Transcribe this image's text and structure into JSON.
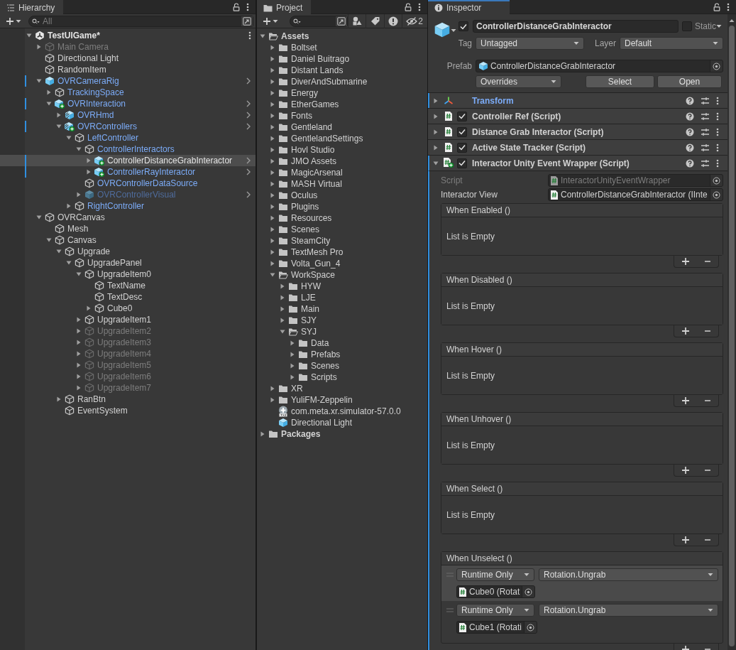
{
  "hierarchy": {
    "tab": "Hierarchy",
    "search": {
      "placeholder": "All"
    },
    "items": [
      {
        "name": "TestUIGame*",
        "kind": "scene",
        "expanded": true,
        "selected": false,
        "children": [
          {
            "name": "Main Camera",
            "kind": "cube",
            "active": false,
            "expanded": false,
            "selected": false
          },
          {
            "name": "Directional Light",
            "kind": "cube",
            "selected": false
          },
          {
            "name": "RandomItem",
            "kind": "cube",
            "selected": false
          },
          {
            "name": "OVRCameraRig",
            "kind": "prefab",
            "prefab": true,
            "modified": true,
            "open_prefab": true,
            "expanded": true,
            "selected": false,
            "children": [
              {
                "name": "TrackingSpace",
                "kind": "cube",
                "prefab": true,
                "expanded": false,
                "selected": false
              },
              {
                "name": "OVRInteraction",
                "kind": "prefab-added",
                "prefab": true,
                "modified": true,
                "open_prefab": true,
                "expanded": true,
                "selected": false,
                "children": [
                  {
                    "name": "OVRHmd",
                    "kind": "variant",
                    "prefab": true,
                    "open_prefab": true,
                    "expanded": false,
                    "selected": false
                  },
                  {
                    "name": "OVRControllers",
                    "kind": "variant-added",
                    "prefab": true,
                    "modified": true,
                    "open_prefab": true,
                    "expanded": true,
                    "selected": false,
                    "children": [
                      {
                        "name": "LeftController",
                        "kind": "cube",
                        "prefab": true,
                        "expanded": true,
                        "selected": false,
                        "children": [
                          {
                            "name": "ControllerInteractors",
                            "kind": "cube",
                            "prefab": true,
                            "expanded": true,
                            "selected": false,
                            "children": [
                              {
                                "name": "ControllerDistanceGrabInteractor",
                                "kind": "prefab-added",
                                "modified": true,
                                "open_prefab": true,
                                "expanded": false,
                                "selected": true
                              },
                              {
                                "name": "ControllerRayInteractor",
                                "kind": "prefab-added",
                                "prefab": true,
                                "modified": true,
                                "open_prefab": true,
                                "expanded": false,
                                "selected": false
                              }
                            ]
                          },
                          {
                            "name": "OVRControllerDataSource",
                            "kind": "cube",
                            "prefab": true,
                            "selected": false
                          },
                          {
                            "name": "OVRControllerVisual",
                            "kind": "prefab",
                            "prefab": true,
                            "active": false,
                            "open_prefab": true,
                            "expanded": false,
                            "selected": false
                          }
                        ]
                      },
                      {
                        "name": "RightController",
                        "kind": "cube",
                        "prefab": true,
                        "expanded": false,
                        "selected": false
                      }
                    ]
                  }
                ]
              }
            ]
          },
          {
            "name": "OVRCanvas",
            "kind": "cube",
            "expanded": true,
            "selected": false,
            "children": [
              {
                "name": "Mesh",
                "kind": "cube",
                "selected": false
              },
              {
                "name": "Canvas",
                "kind": "cube",
                "expanded": true,
                "selected": false,
                "children": [
                  {
                    "name": "Upgrade",
                    "kind": "cube",
                    "expanded": true,
                    "selected": false,
                    "children": [
                      {
                        "name": "UpgradePanel",
                        "kind": "cube",
                        "expanded": true,
                        "selected": false,
                        "children": [
                          {
                            "name": "UpgradeItem0",
                            "kind": "cube",
                            "expanded": true,
                            "selected": false,
                            "children": [
                              {
                                "name": "TextName",
                                "kind": "cube",
                                "selected": false
                              },
                              {
                                "name": "TextDesc",
                                "kind": "cube",
                                "selected": false
                              },
                              {
                                "name": "Cube0",
                                "kind": "cube",
                                "expanded": false,
                                "selected": false
                              }
                            ]
                          },
                          {
                            "name": "UpgradeItem1",
                            "kind": "cube",
                            "expanded": false,
                            "selected": false
                          },
                          {
                            "name": "UpgradeItem2",
                            "kind": "cube",
                            "active": false,
                            "expanded": false,
                            "selected": false
                          },
                          {
                            "name": "UpgradeItem3",
                            "kind": "cube",
                            "active": false,
                            "expanded": false,
                            "selected": false
                          },
                          {
                            "name": "UpgradeItem4",
                            "kind": "cube",
                            "active": false,
                            "expanded": false,
                            "selected": false
                          },
                          {
                            "name": "UpgradeItem5",
                            "kind": "cube",
                            "active": false,
                            "expanded": false,
                            "selected": false
                          },
                          {
                            "name": "UpgradeItem6",
                            "kind": "cube",
                            "active": false,
                            "expanded": false,
                            "selected": false
                          },
                          {
                            "name": "UpgradeItem7",
                            "kind": "cube",
                            "active": false,
                            "expanded": false,
                            "selected": false
                          }
                        ]
                      }
                    ]
                  },
                  {
                    "name": "RanBtn",
                    "kind": "cube",
                    "expanded": false,
                    "selected": false
                  },
                  {
                    "name": "EventSystem",
                    "kind": "cube",
                    "selected": false
                  }
                ]
              }
            ]
          }
        ]
      }
    ]
  },
  "project": {
    "tab": "Project",
    "hidden_count": "2",
    "items": [
      {
        "name": "Assets",
        "kind": "root",
        "expanded": true,
        "selected": false,
        "children": [
          {
            "name": "Boltset",
            "kind": "folder",
            "expanded": false,
            "selected": false
          },
          {
            "name": "Daniel Buitrago",
            "kind": "folder",
            "expanded": false,
            "selected": false
          },
          {
            "name": "Distant Lands",
            "kind": "folder",
            "expanded": false,
            "selected": false
          },
          {
            "name": "DiverAndSubmarine",
            "kind": "folder",
            "expanded": false,
            "selected": false
          },
          {
            "name": "Energy",
            "kind": "folder",
            "expanded": false,
            "selected": false
          },
          {
            "name": "EtherGames",
            "kind": "folder",
            "expanded": false,
            "selected": false
          },
          {
            "name": "Fonts",
            "kind": "folder",
            "expanded": false,
            "selected": false
          },
          {
            "name": "Gentleland",
            "kind": "folder",
            "expanded": false,
            "selected": false
          },
          {
            "name": "GentlelandSettings",
            "kind": "folder",
            "expanded": false,
            "selected": false
          },
          {
            "name": "Hovl Studio",
            "kind": "folder",
            "expanded": false,
            "selected": false
          },
          {
            "name": "JMO Assets",
            "kind": "folder",
            "expanded": false,
            "selected": false
          },
          {
            "name": "MagicArsenal",
            "kind": "folder",
            "expanded": false,
            "selected": false
          },
          {
            "name": "MASH Virtual",
            "kind": "folder",
            "expanded": false,
            "selected": false
          },
          {
            "name": "Oculus",
            "kind": "folder",
            "expanded": false,
            "selected": false
          },
          {
            "name": "Plugins",
            "kind": "folder",
            "expanded": false,
            "selected": false
          },
          {
            "name": "Resources",
            "kind": "folder",
            "expanded": false,
            "selected": false
          },
          {
            "name": "Scenes",
            "kind": "folder",
            "expanded": false,
            "selected": false
          },
          {
            "name": "SteamCity",
            "kind": "folder",
            "expanded": false,
            "selected": false
          },
          {
            "name": "TextMesh Pro",
            "kind": "folder",
            "expanded": false,
            "selected": false
          },
          {
            "name": "Volta_Gun_4",
            "kind": "folder",
            "expanded": false,
            "selected": false
          },
          {
            "name": "WorkSpace",
            "kind": "folder",
            "expanded": true,
            "selected": false,
            "children": [
              {
                "name": "HYW",
                "kind": "folder",
                "expanded": false,
                "selected": false
              },
              {
                "name": "LJE",
                "kind": "folder",
                "expanded": false,
                "selected": false
              },
              {
                "name": "Main",
                "kind": "folder",
                "expanded": false,
                "selected": false
              },
              {
                "name": "SJY",
                "kind": "folder",
                "expanded": false,
                "selected": false
              },
              {
                "name": "SYJ",
                "kind": "folder",
                "expanded": true,
                "selected": false,
                "children": [
                  {
                    "name": "Data",
                    "kind": "folder",
                    "expanded": false,
                    "selected": false
                  },
                  {
                    "name": "Prefabs",
                    "kind": "folder",
                    "expanded": false,
                    "selected": false
                  },
                  {
                    "name": "Scenes",
                    "kind": "folder",
                    "expanded": false,
                    "selected": false
                  },
                  {
                    "name": "Scripts",
                    "kind": "folder",
                    "expanded": false,
                    "selected": false
                  }
                ]
              }
            ]
          },
          {
            "name": "XR",
            "kind": "folder",
            "expanded": false,
            "selected": false
          },
          {
            "name": "YuliFM-Zeppelin",
            "kind": "folder",
            "expanded": false,
            "selected": false
          },
          {
            "name": "com.meta.xr.simulator-57.0.0",
            "kind": "package",
            "selected": false
          },
          {
            "name": "Directional Light",
            "kind": "prefab",
            "selected": false
          }
        ]
      },
      {
        "name": "Packages",
        "kind": "root",
        "expanded": false,
        "selected": false
      }
    ]
  },
  "inspector": {
    "tab": "Inspector",
    "focused": true,
    "object": {
      "active": true,
      "name": "ControllerDistanceGrabInteractor",
      "static": false,
      "static_label": "Static",
      "tag_label": "Tag",
      "tag": "Untagged",
      "layer_label": "Layer",
      "layer": "Default",
      "prefab_label": "Prefab",
      "prefab": "ControllerDistanceGrabInteractor",
      "overrides": "Overrides",
      "buttons": [
        "Select",
        "Open"
      ]
    },
    "components": [
      {
        "name": "Transform",
        "kind": "transform",
        "expanded": false,
        "modified": true
      },
      {
        "name": "Controller Ref (Script)",
        "kind": "script",
        "enabled": true,
        "expanded": false
      },
      {
        "name": "Distance Grab Interactor (Script)",
        "kind": "script",
        "enabled": true,
        "expanded": false
      },
      {
        "name": "Active State Tracker (Script)",
        "kind": "script",
        "enabled": true,
        "expanded": false
      },
      {
        "name": "Interactor Unity Event Wrapper (Script)",
        "kind": "script-added",
        "enabled": true,
        "expanded": true,
        "modified": true
      }
    ],
    "fields": [
      {
        "label": "Script",
        "value": "InteractorUnityEventWrapper",
        "disabled": true
      },
      {
        "label": "Interactor View",
        "value": "ControllerDistanceGrabInteractor (IInte",
        "disabled": false
      }
    ],
    "events": [
      {
        "title": "When Enabled ()",
        "empty_text": "List is Empty"
      },
      {
        "title": "When Disabled ()",
        "empty_text": "List is Empty"
      },
      {
        "title": "When Hover ()",
        "empty_text": "List is Empty"
      },
      {
        "title": "When Unhover ()",
        "empty_text": "List is Empty"
      },
      {
        "title": "When Select ()",
        "empty_text": "List is Empty"
      },
      {
        "title": "When Unselect ()",
        "entries": [
          {
            "mode": "Runtime Only",
            "function": "Rotation.Ungrab",
            "target": "Cube0 (Rotat",
            "selected": true
          },
          {
            "mode": "Runtime Only",
            "function": "Rotation.Ungrab",
            "target": "Cube1 (Rotati",
            "selected": false
          }
        ]
      }
    ]
  }
}
